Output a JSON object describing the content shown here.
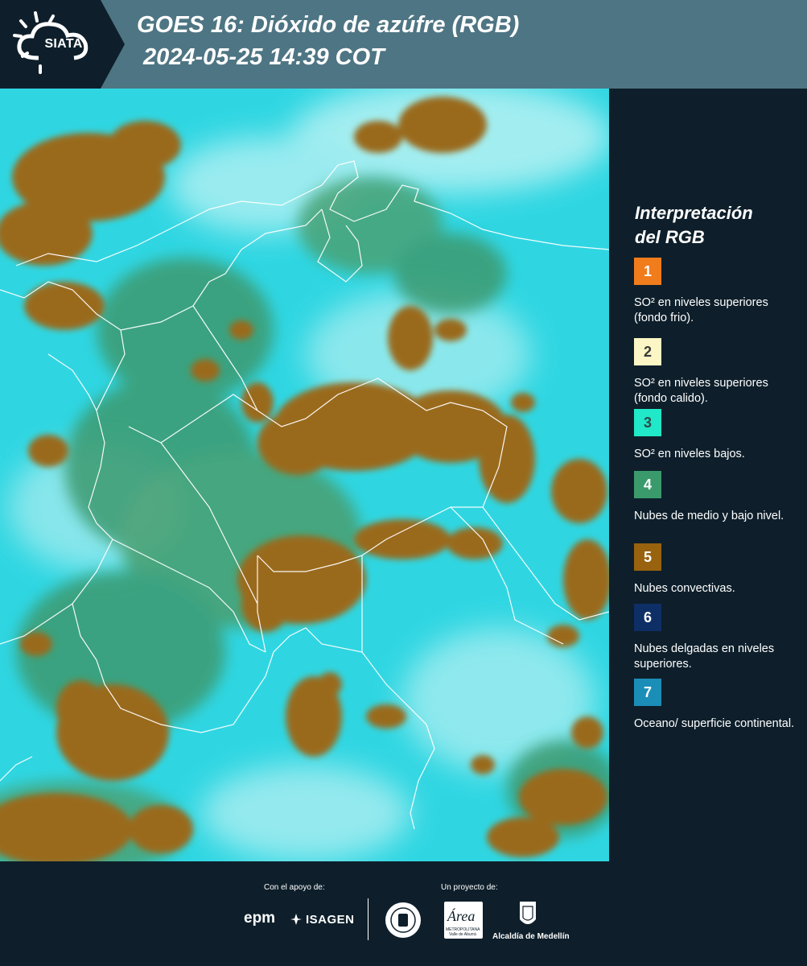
{
  "header": {
    "logo_text": "SIATA",
    "title_line1": "GOES 16: Dióxido de azúfre (RGB)",
    "title_line2": "2024-05-25 14:39 COT"
  },
  "legend": {
    "title_line1": "Interpretación",
    "title_line2": "del RGB",
    "items": [
      {
        "number": "1",
        "color": "#f07c1c",
        "text_color": "#ffffff",
        "description": "SO² en niveles superiores (fondo frio)."
      },
      {
        "number": "2",
        "color": "#fcf5c5",
        "text_color": "#3a3a3a",
        "description": "SO² en niveles superiores (fondo calido)."
      },
      {
        "number": "3",
        "color": "#20e8c8",
        "text_color": "#2d4a4a",
        "description": "SO² en niveles bajos."
      },
      {
        "number": "4",
        "color": "#3b9a6c",
        "text_color": "#ffffff",
        "description": "Nubes de medio y bajo nivel."
      },
      {
        "number": "5",
        "color": "#98620e",
        "text_color": "#ffffff",
        "description": "Nubes convectivas."
      },
      {
        "number": "6",
        "color": "#0d2f66",
        "text_color": "#ffffff",
        "description": "Nubes delgadas en niveles superiores."
      },
      {
        "number": "7",
        "color": "#1b8eb8",
        "text_color": "#ffffff",
        "description": "Oceano/ superficie continental."
      }
    ]
  },
  "footer": {
    "support_label": "Con el apoyo de:",
    "project_label": "Un proyecto de:",
    "sponsor1": "epm",
    "sponsor2": "ISAGEN",
    "partner_logo_text": "Área",
    "partner_sub1": "METROPOLITANA",
    "partner_sub2": "Valle de Aburrá",
    "partner2": "Alcaldía de Medellín"
  },
  "colors": {
    "header_bg": "#4e7583",
    "logo_bg": "#0e1f2b",
    "panel_bg": "#0e1f2b",
    "map_surface": "#2fd6e2",
    "map_cloud": "#9a6a1c",
    "map_midcloud": "#3e9a70"
  }
}
